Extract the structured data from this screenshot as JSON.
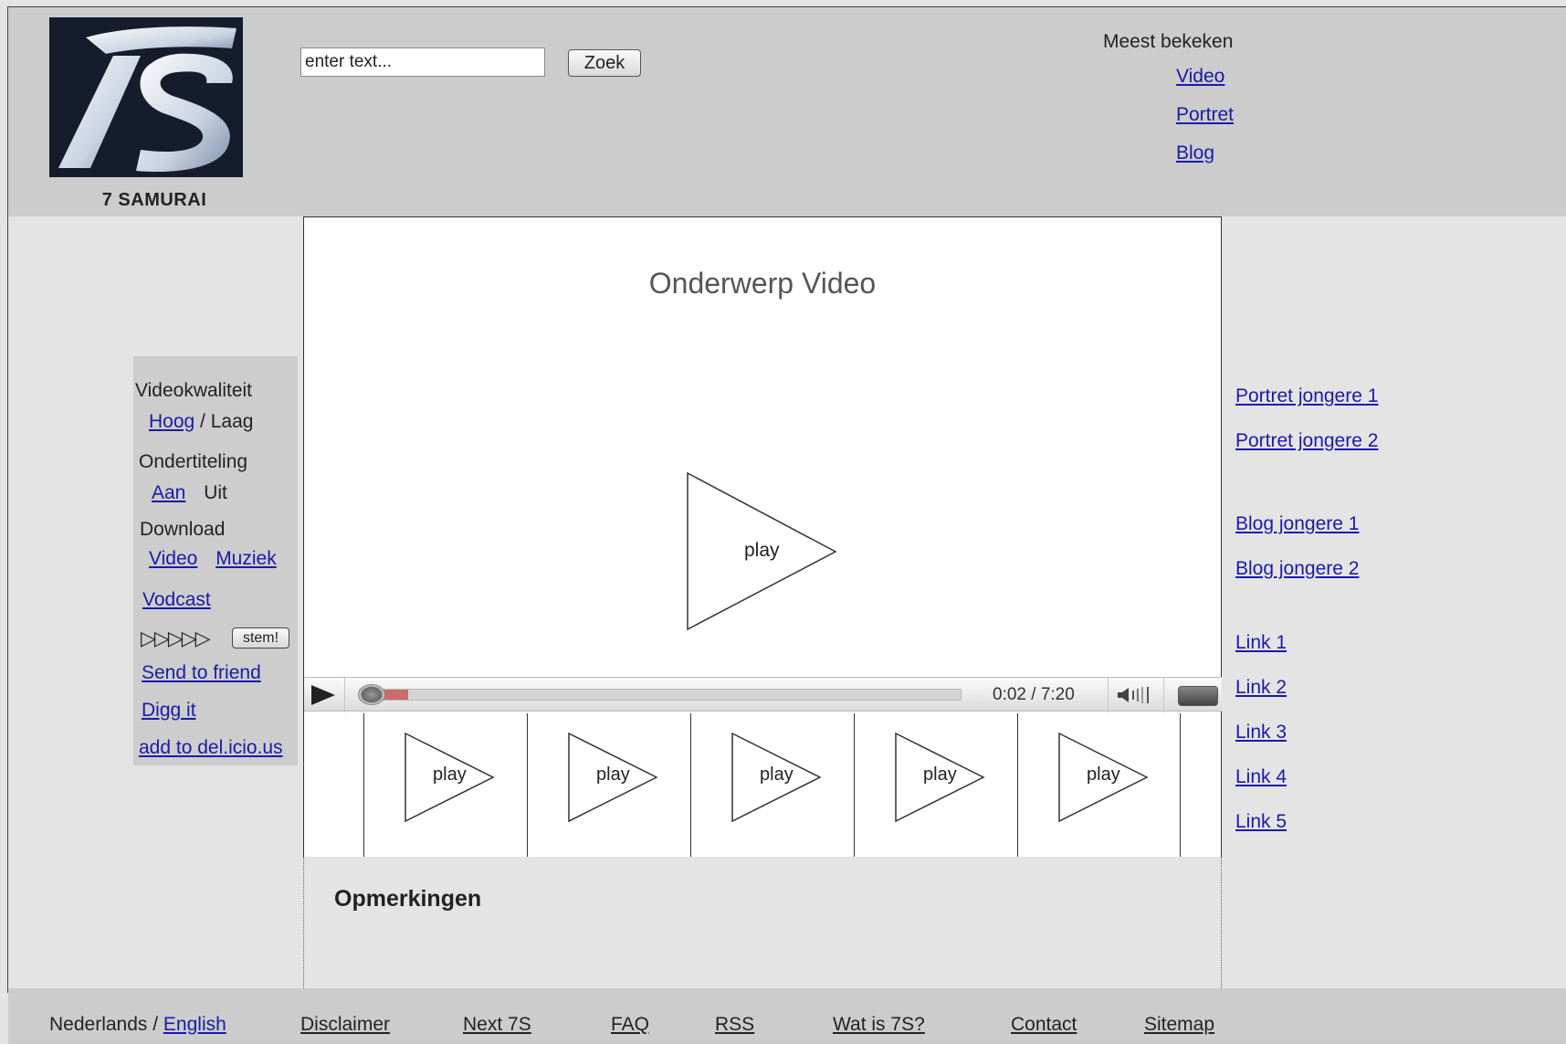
{
  "header": {
    "logo_text": "7S",
    "brand_name": "7 SAMURAI",
    "search": {
      "value": "enter text...",
      "button_label": "Zoek"
    },
    "most_viewed": {
      "title": "Meest bekeken",
      "links": [
        "Video",
        "Portret",
        "Blog"
      ]
    }
  },
  "main": {
    "title": "Onderwerp Video",
    "player": {
      "play_label": "play",
      "time": "0:02 / 7:20",
      "progress_fraction": 0.08
    },
    "thumbnails": [
      "play",
      "play",
      "play",
      "play",
      "play"
    ],
    "comments_title": "Opmerkingen"
  },
  "options": {
    "quality_label": "Videokwaliteit",
    "quality_high": "Hoog",
    "quality_sep": "/",
    "quality_low": "Laag",
    "subtitles_label": "Ondertiteling",
    "subtitles_on": "Aan",
    "subtitles_off": "Uit",
    "download_label": "Download",
    "download_video": "Video",
    "download_music": "Muziek",
    "vodcast": "Vodcast",
    "rating_stars": "▷▷▷▷▷",
    "vote_label": "stem!",
    "send_to_friend": "Send to friend",
    "digg": "Digg it",
    "delicious": "add to del.icio.us"
  },
  "side_links": [
    "Portret jongere 1",
    "Portret jongere 2",
    "Blog jongere 1",
    "Blog jongere 2",
    "Link 1",
    "Link 2",
    "Link 3",
    "Link 4",
    "Link 5"
  ],
  "footer": {
    "lang_current": "Nederlands /",
    "lang_other": "English",
    "links": [
      "Disclaimer",
      "Next 7S",
      "FAQ",
      "RSS",
      "Wat is 7S?",
      "Contact",
      "Sitemap"
    ]
  },
  "colors": {
    "header_bg": "#cccccc",
    "page_bg": "#e4e4e4",
    "link": "#1a1aa8",
    "progress_fill": "#c76b6b"
  },
  "icons": [
    "play-triangle-icon",
    "volume-icon",
    "fullscreen-icon",
    "knob-icon"
  ]
}
